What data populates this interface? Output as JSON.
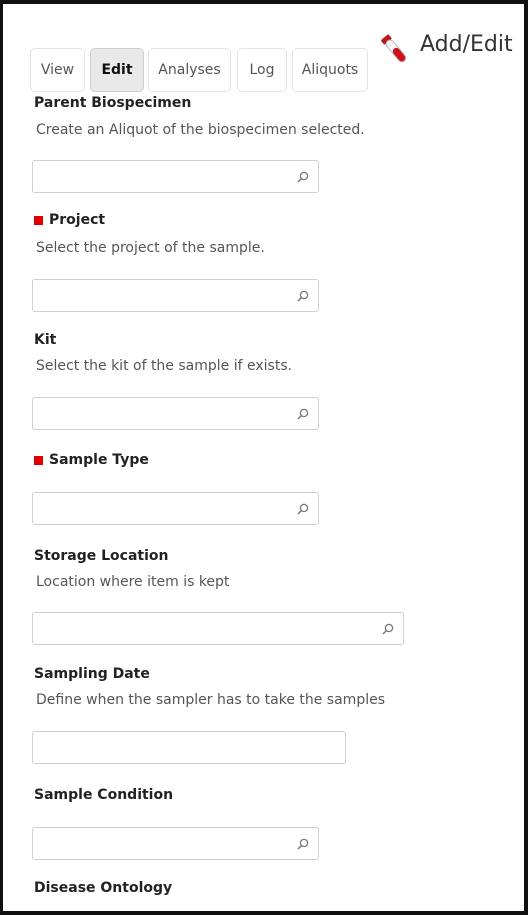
{
  "tabs": [
    {
      "label": "View",
      "active": false
    },
    {
      "label": "Edit",
      "active": true
    },
    {
      "label": "Analyses",
      "active": false
    },
    {
      "label": "Log",
      "active": false
    },
    {
      "label": "Aliquots",
      "active": false
    }
  ],
  "header": {
    "title": "Add/Edit",
    "icon": "test-tube-icon"
  },
  "colors": {
    "required": "#e00000",
    "tube_red": "#d0101a"
  },
  "fields": {
    "parent_biospecimen": {
      "label": "Parent Biospecimen",
      "description": "Create an Aliquot of the biospecimen selected.",
      "value": ""
    },
    "project": {
      "label": "Project",
      "description": "Select the project of the sample.",
      "value": "",
      "required": true
    },
    "kit": {
      "label": "Kit",
      "description": "Select the kit of the sample if exists.",
      "value": ""
    },
    "sample_type": {
      "label": "Sample Type",
      "value": "",
      "required": true
    },
    "storage_location": {
      "label": "Storage Location",
      "description": "Location where item is kept",
      "value": ""
    },
    "sampling_date": {
      "label": "Sampling Date",
      "description": "Define when the sampler has to take the samples",
      "value": ""
    },
    "sample_condition": {
      "label": "Sample Condition",
      "value": ""
    },
    "disease_ontology": {
      "label": "Disease Ontology"
    }
  }
}
